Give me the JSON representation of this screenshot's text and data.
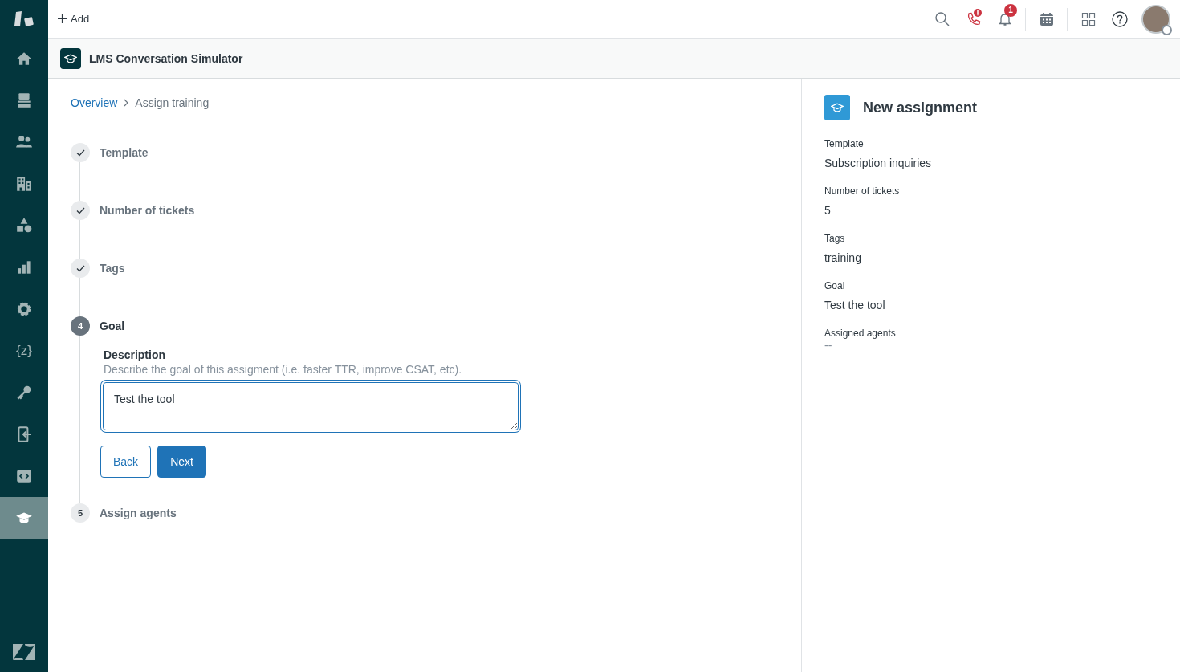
{
  "sidebar": {
    "items": [
      {
        "kind": "home",
        "selected": false
      },
      {
        "kind": "inbox",
        "selected": false
      },
      {
        "kind": "people",
        "selected": false
      },
      {
        "kind": "building",
        "selected": false
      },
      {
        "kind": "shapes",
        "selected": false
      },
      {
        "kind": "chart",
        "selected": false
      },
      {
        "kind": "gear",
        "selected": false
      },
      {
        "kind": "glyph",
        "glyph": "{z}",
        "selected": false
      },
      {
        "kind": "key",
        "selected": false
      },
      {
        "kind": "mobile",
        "selected": false
      },
      {
        "kind": "code",
        "selected": false
      },
      {
        "kind": "cap",
        "selected": true
      }
    ]
  },
  "topbar": {
    "add_label": "Add",
    "notification_count": "1",
    "phone_alert": true
  },
  "app_header": {
    "title": "LMS Conversation Simulator"
  },
  "breadcrumb": [
    {
      "label": "Overview",
      "link": true
    },
    {
      "label": "Assign training",
      "link": false
    }
  ],
  "steps": [
    {
      "label": "Template",
      "kind": "done"
    },
    {
      "label": "Number of tickets",
      "kind": "done"
    },
    {
      "label": "Tags",
      "kind": "done"
    },
    {
      "label": "Goal",
      "kind": "current",
      "number": "4"
    },
    {
      "label": "Assign agents",
      "kind": "pending",
      "number": "5"
    }
  ],
  "goal_form": {
    "label": "Description",
    "hint": "Describe the goal of this assigment (i.e. faster TTR, improve CSAT, etc).",
    "value": "Test the tool",
    "buttons": [
      {
        "label": "Back",
        "kind": "secondary"
      },
      {
        "label": "Next",
        "kind": "primary"
      }
    ]
  },
  "summary": {
    "title": "New assignment",
    "fields": [
      {
        "label": "Template",
        "value": "Subscription inquiries",
        "empty": false
      },
      {
        "label": "Number of tickets",
        "value": "5",
        "empty": false
      },
      {
        "label": "Tags",
        "value": "training",
        "empty": false
      },
      {
        "label": "Goal",
        "value": "Test the tool",
        "empty": false
      },
      {
        "label": "Assigned agents",
        "value": "--",
        "empty": true
      }
    ]
  }
}
